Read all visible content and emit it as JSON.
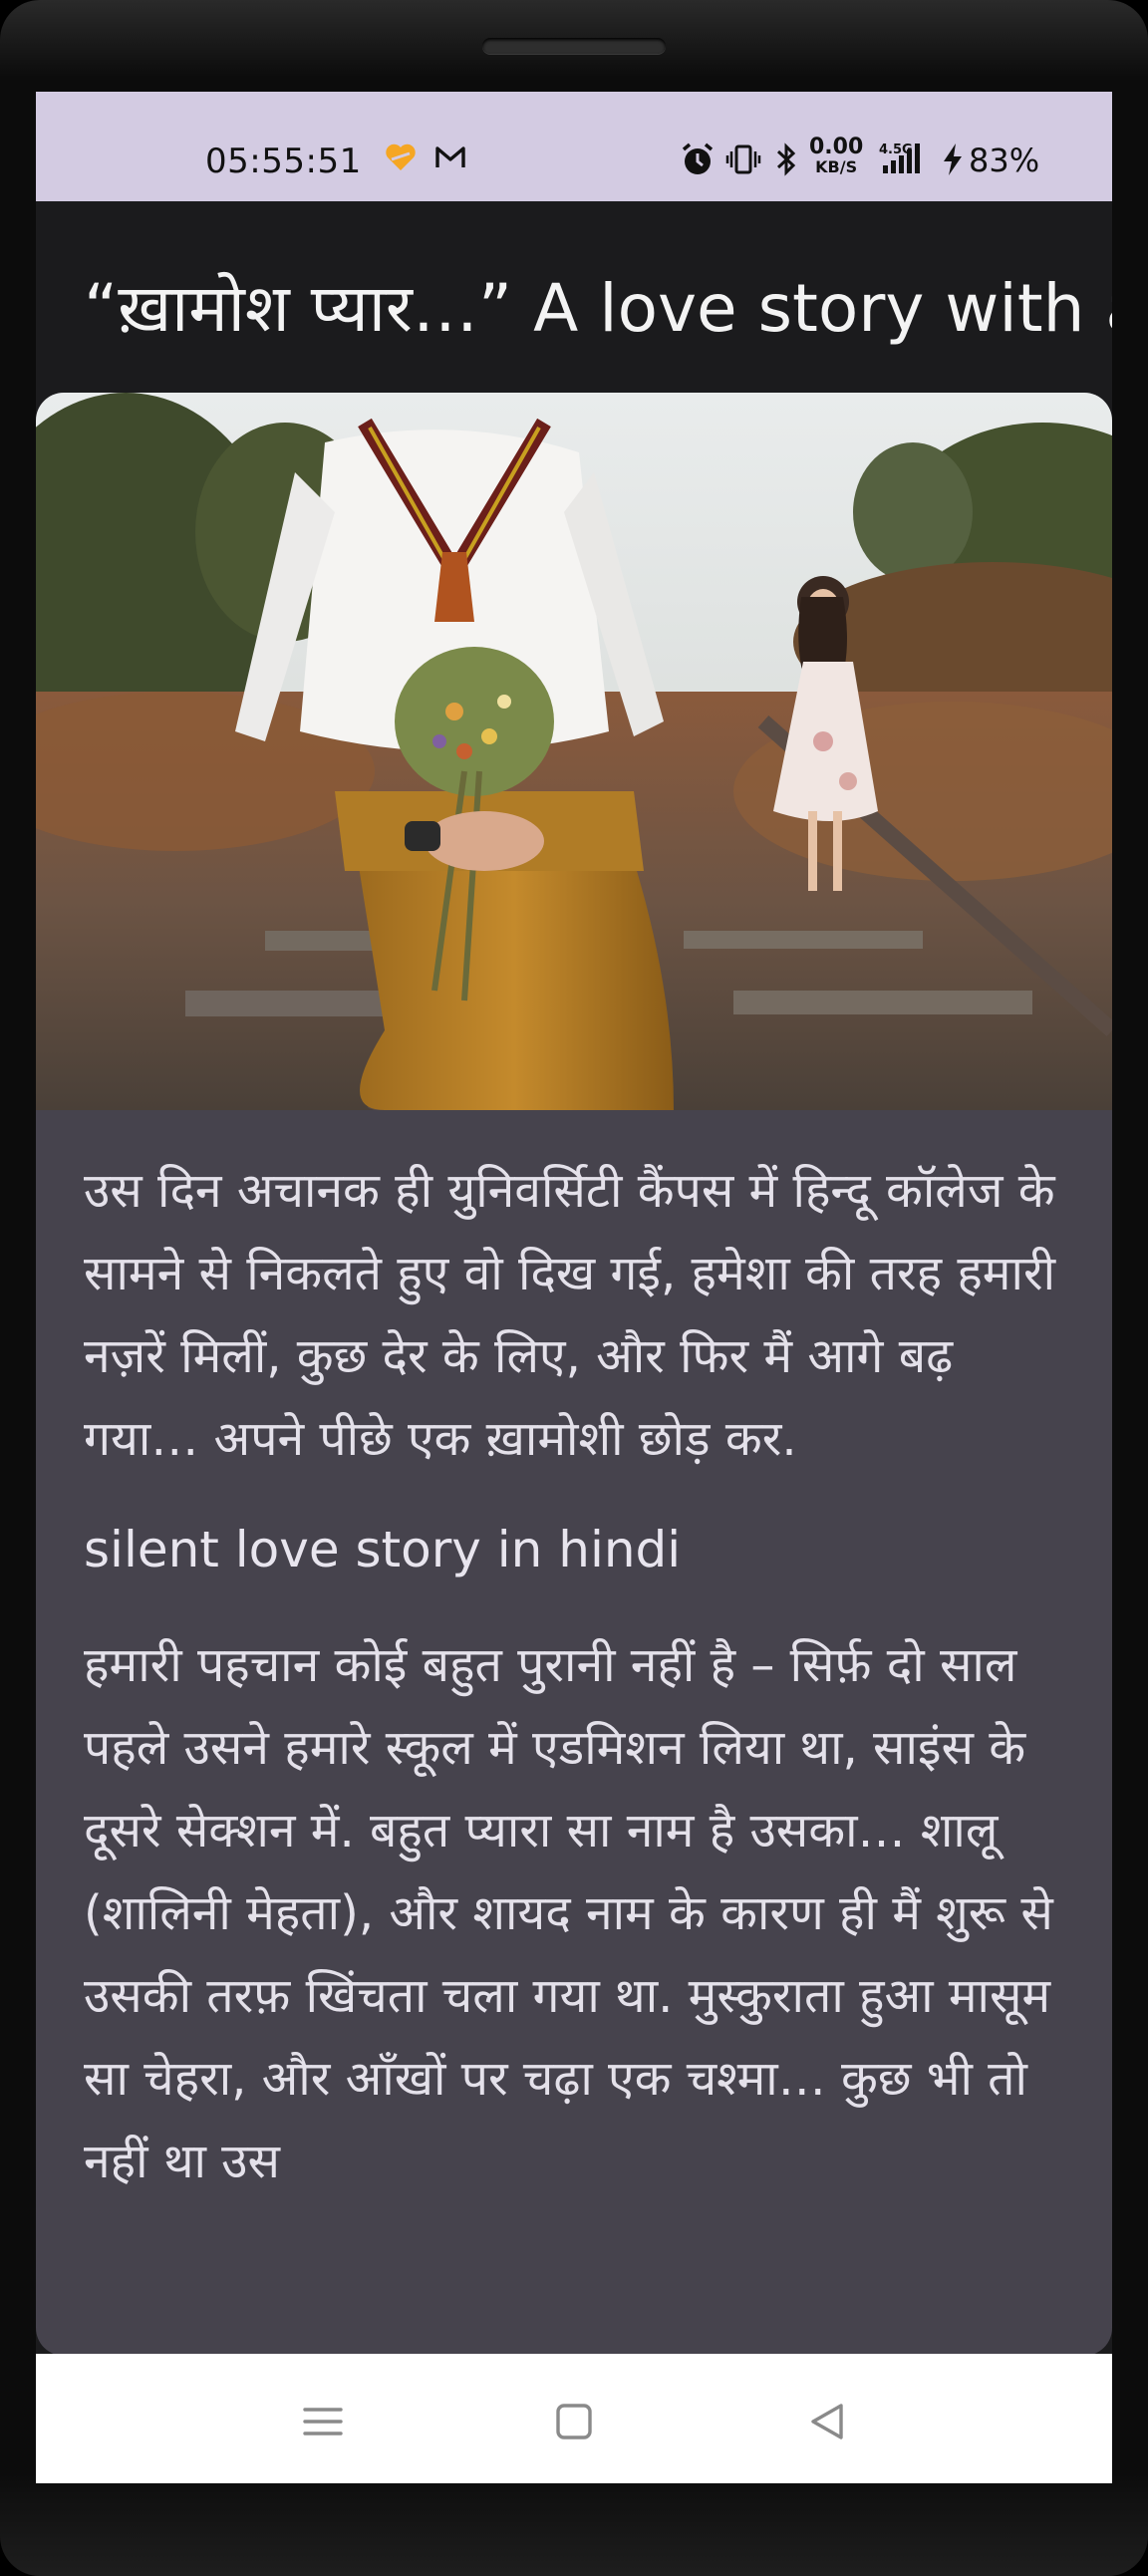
{
  "status_bar": {
    "time": "05:55:51",
    "net_speed_value": "0.00",
    "net_speed_unit": "KB/S",
    "network_type": "4.5G",
    "battery": "83%"
  },
  "article": {
    "title": "“ख़ामोश प्यार…” A love story with a",
    "paragraph_1": "उस दिन अचानक ही युनिवर्सिटी कैंपस में हिन्दू कॉलेज के सामने से निकलते हुए वो दिख गई, हमेशा की तरह हमारी नज़रें मिलीं, कुछ देर के लिए, और फिर मैं आगे बढ़ गया… अपने पीछे एक ख़ामोशी छोड़ कर.",
    "subheading": "silent love story in hindi",
    "paragraph_2": "हमारी पहचान कोई बहुत पुरानी नहीं है – सिर्फ़ दो साल पहले उसने हमारे स्कूल में एडमिशन लिया था, साइंस के दूसरे सेक्शन में. बहुत प्यारा सा नाम है उसका… शालू (शालिनी मेहता), और शायद नाम के कारण ही मैं शुरू से उसकी तरफ़ खिंचता चला गया था. मुस्कुराता हुआ मासूम सा चेहरा, और आँखों पर चढ़ा एक चश्मा… कुछ भी तो नहीं था उस"
  },
  "colors": {
    "status_bar_bg": "#d3cbe2",
    "screen_bg": "#1b1b1d",
    "card_bg": "#46434d",
    "body_text": "#e4e1ea",
    "nav_bg": "#ffffff",
    "battery_heart_accent": "#f5a623"
  },
  "icons": {
    "status": [
      "app-heart-icon",
      "gmail-icon",
      "alarm-icon",
      "vibrate-icon",
      "bluetooth-icon",
      "signal-icon",
      "charging-icon"
    ],
    "nav": [
      "menu-icon",
      "home-icon",
      "back-icon"
    ]
  }
}
